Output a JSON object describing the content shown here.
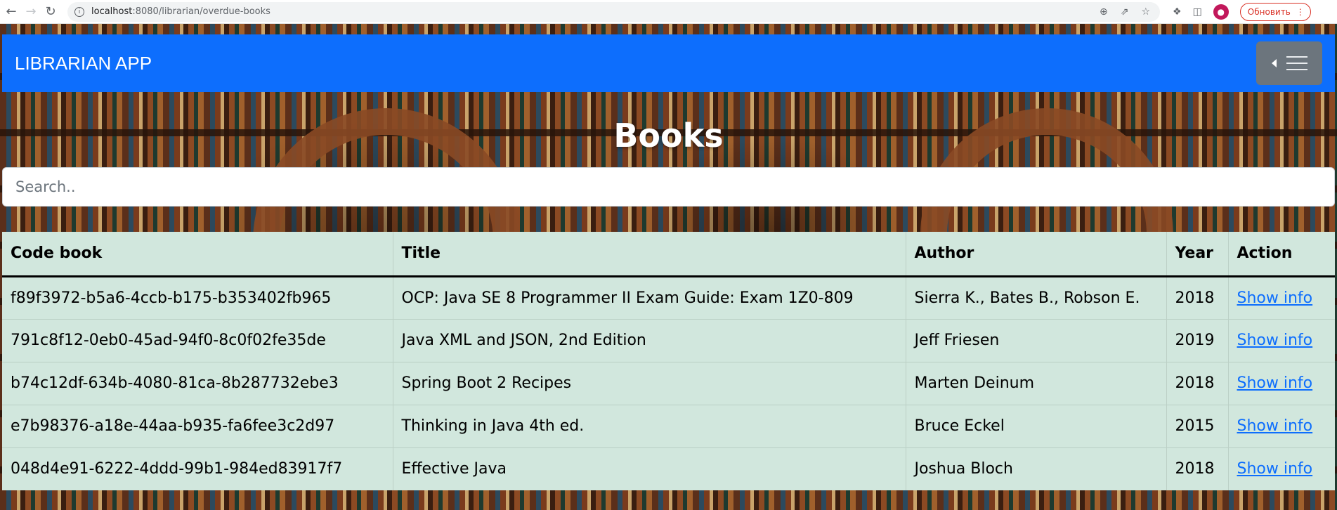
{
  "browser": {
    "url_host": "localhost",
    "url_path": ":8080/librarian/overdue-books",
    "update_label": "Обновить"
  },
  "navbar": {
    "brand": "LIBRARIAN APP"
  },
  "page": {
    "heading": "Books",
    "search_placeholder": "Search.."
  },
  "table": {
    "headers": [
      "Code book",
      "Title",
      "Author",
      "Year",
      "Action"
    ],
    "rows": [
      {
        "code": "f89f3972-b5a6-4ccb-b175-b353402fb965",
        "title": "OCP: Java SE 8 Programmer II Exam Guide: Exam 1Z0-809",
        "author": "Sierra K., Bates B., Robson E.",
        "year": "2018",
        "action": "Show info"
      },
      {
        "code": "791c8f12-0eb0-45ad-94f0-8c0f02fe35de",
        "title": "Java XML and JSON, 2nd Edition",
        "author": "Jeff Friesen",
        "year": "2019",
        "action": "Show info"
      },
      {
        "code": "b74c12df-634b-4080-81ca-8b287732ebe3",
        "title": "Spring Boot 2 Recipes",
        "author": "Marten Deinum",
        "year": "2018",
        "action": "Show info"
      },
      {
        "code": "e7b98376-a18e-44aa-b935-fa6fee3c2d97",
        "title": "Thinking in Java 4th ed.",
        "author": "Bruce Eckel",
        "year": "2015",
        "action": "Show info"
      },
      {
        "code": "048d4e91-6222-4ddd-99b1-984ed83917f7",
        "title": "Effective Java",
        "author": "Joshua Bloch",
        "year": "2018",
        "action": "Show info"
      }
    ]
  }
}
